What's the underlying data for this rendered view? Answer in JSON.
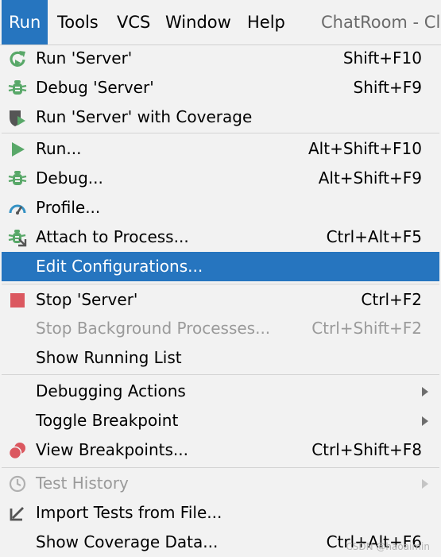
{
  "menubar": {
    "items": [
      "Run",
      "Tools",
      "VCS",
      "Window",
      "Help"
    ],
    "title": "ChatRoom - Cli"
  },
  "menu": {
    "groups": [
      [
        {
          "label": "Run 'Server'",
          "shortcut": "Shift+F10",
          "icon": "rerun-icon"
        },
        {
          "label": "Debug 'Server'",
          "shortcut": "Shift+F9",
          "icon": "debug-icon"
        },
        {
          "label": "Run 'Server' with Coverage",
          "shortcut": "",
          "icon": "coverage-icon"
        }
      ],
      [
        {
          "label": "Run...",
          "shortcut": "Alt+Shift+F10",
          "icon": "play-icon"
        },
        {
          "label": "Debug...",
          "shortcut": "Alt+Shift+F9",
          "icon": "debug-icon"
        },
        {
          "label": "Profile...",
          "shortcut": "",
          "icon": "profiler-gauge-icon"
        },
        {
          "label": "Attach to Process...",
          "shortcut": "Ctrl+Alt+F5",
          "icon": "attach-debugger-icon"
        },
        {
          "label": "Edit Configurations...",
          "shortcut": "",
          "icon": "",
          "selected": true
        }
      ],
      [
        {
          "label": "Stop 'Server'",
          "shortcut": "Ctrl+F2",
          "icon": "stop-icon"
        },
        {
          "label": "Stop Background Processes...",
          "shortcut": "Ctrl+Shift+F2",
          "icon": "",
          "disabled": true
        },
        {
          "label": "Show Running List",
          "shortcut": "",
          "icon": ""
        }
      ],
      [
        {
          "label": "Debugging Actions",
          "shortcut": "",
          "icon": "",
          "submenu": true
        },
        {
          "label": "Toggle Breakpoint",
          "shortcut": "",
          "icon": "",
          "submenu": true
        },
        {
          "label": "View Breakpoints...",
          "shortcut": "Ctrl+Shift+F8",
          "icon": "breakpoints-icon"
        }
      ],
      [
        {
          "label": "Test History",
          "shortcut": "",
          "icon": "history-clock-icon",
          "disabled": true,
          "submenu": true
        },
        {
          "label": "Import Tests from File...",
          "shortcut": "",
          "icon": "import-arrow-icon"
        },
        {
          "label": "Show Coverage Data...",
          "shortcut": "Ctrl+Alt+F6",
          "icon": ""
        }
      ]
    ]
  },
  "colors": {
    "accent": "#2675bf",
    "green": "#59a869",
    "red": "#db5860",
    "blue": "#3592c4",
    "disabled": "#9a9a9a"
  },
  "watermark": "CSDN @haoaimin"
}
